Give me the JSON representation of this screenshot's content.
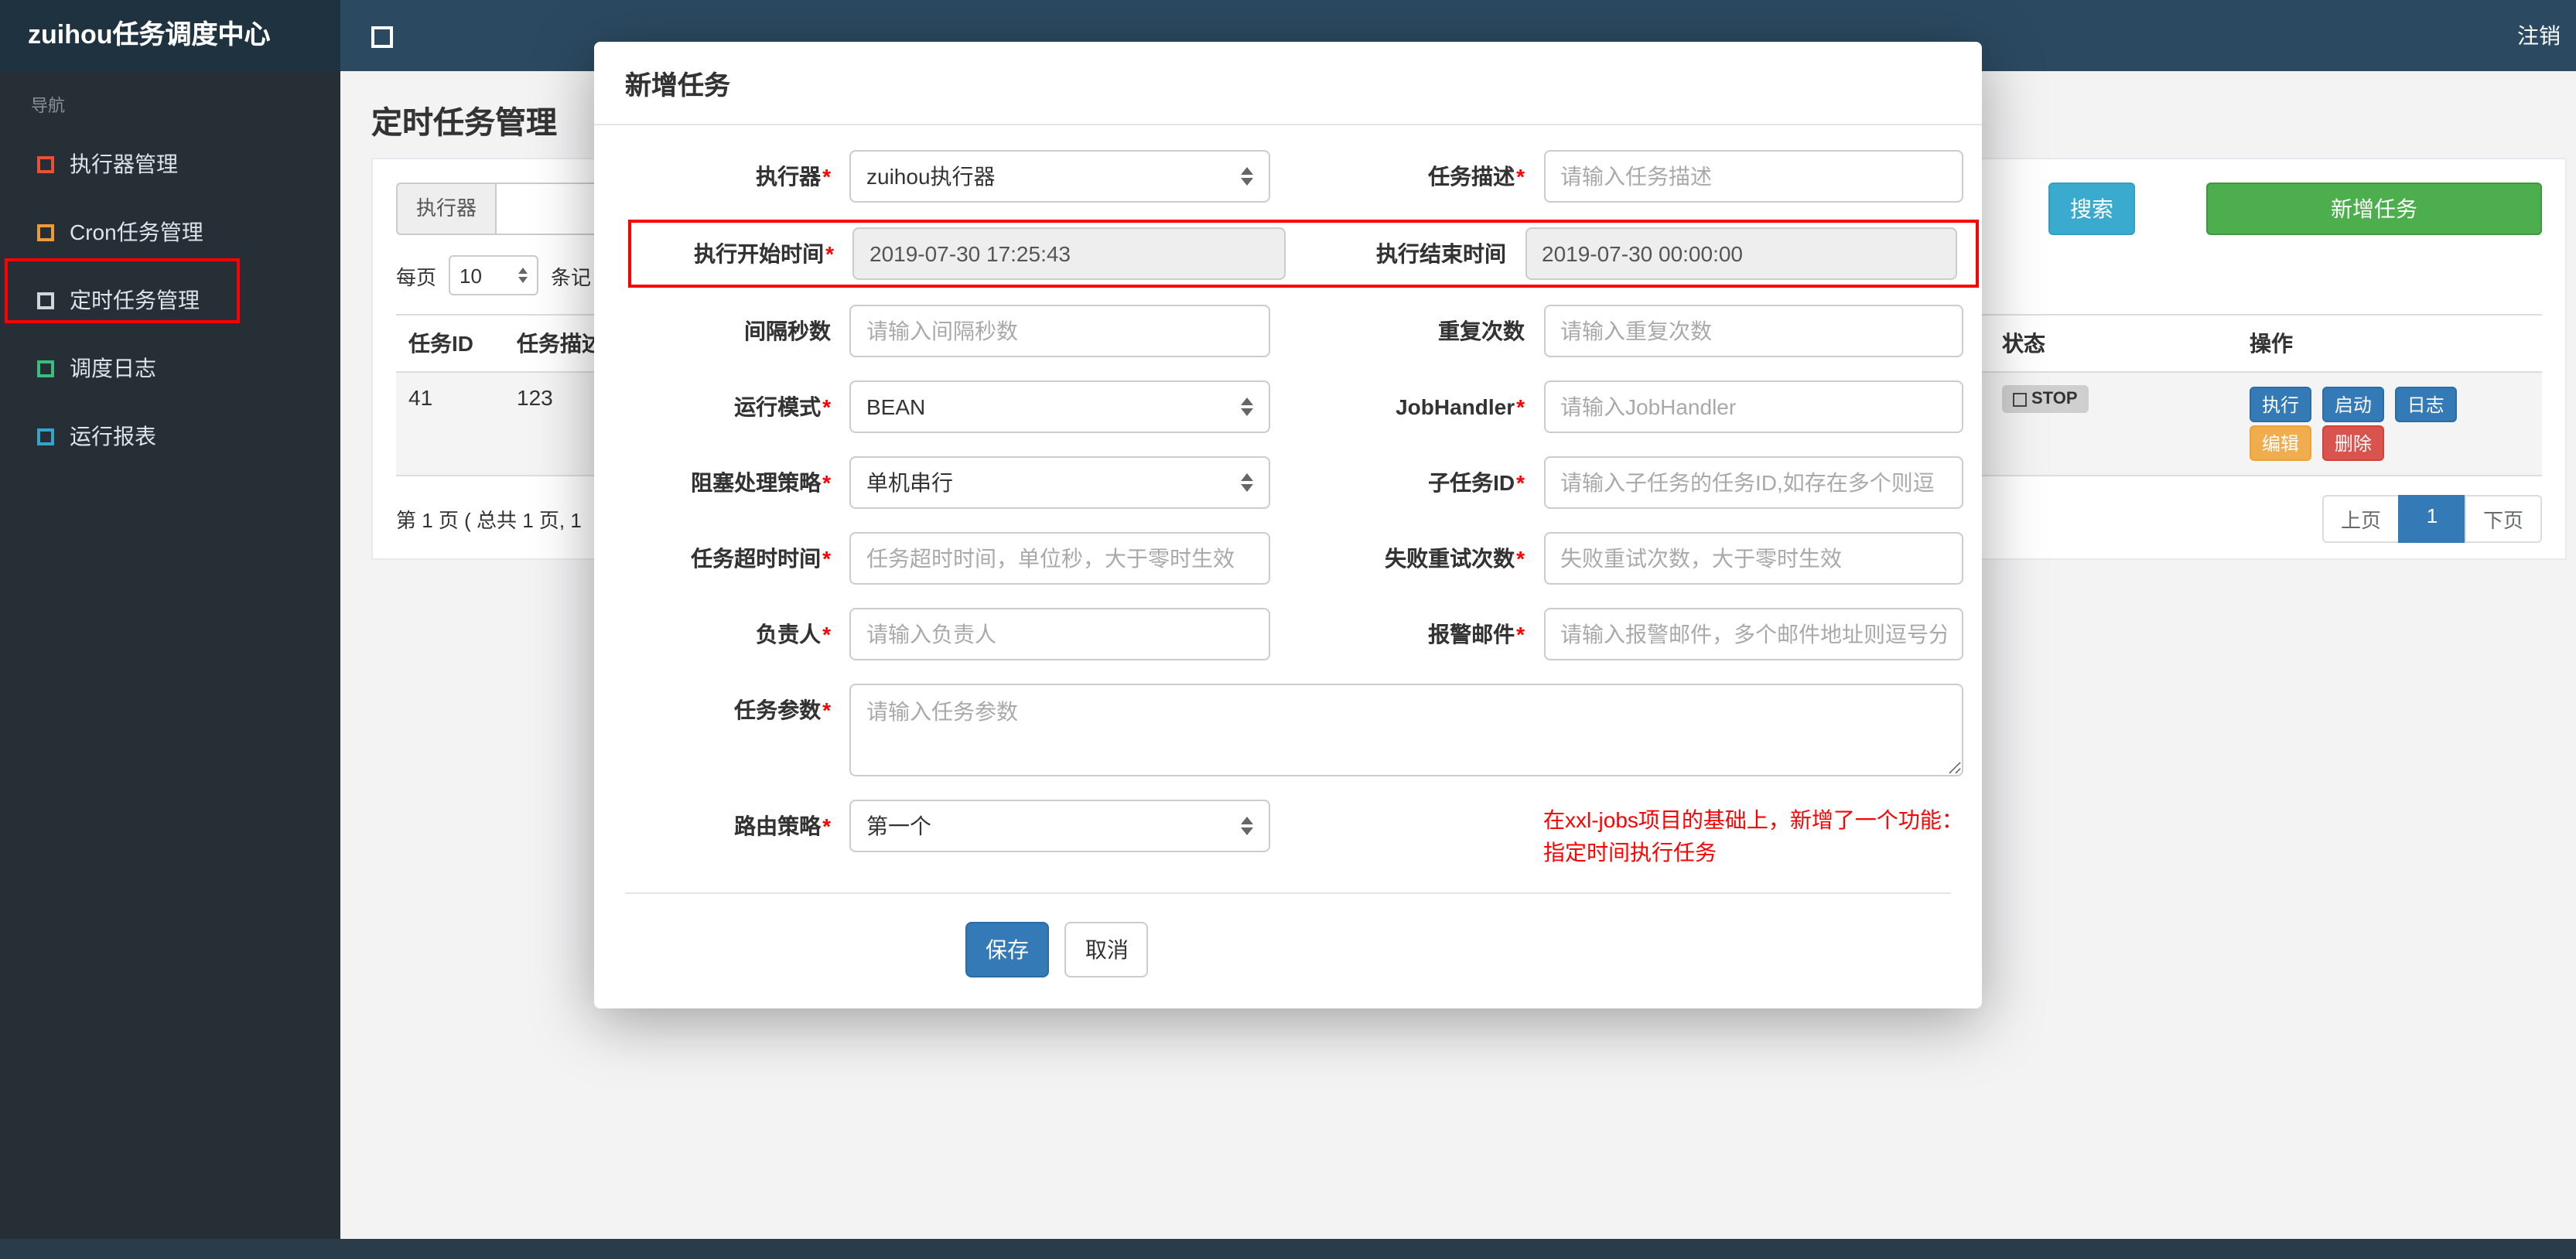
{
  "colors": {
    "navbar": "#2b4a61",
    "brand_bg": "#1e3240",
    "sidebar_bg": "#262f36",
    "annotation": "#ff0000",
    "search_button": "#3aabcf",
    "add_button": "#4cae4c",
    "primary_button": "#337ab7",
    "warning_button": "#f0ad4e",
    "danger_button": "#d9534f"
  },
  "navbar": {
    "brand": "zuihou任务调度中心",
    "logout": "注销"
  },
  "sidebar": {
    "section_label": "导航",
    "items": [
      {
        "label": "执行器管理"
      },
      {
        "label": "Cron任务管理"
      },
      {
        "label": "定时任务管理"
      },
      {
        "label": "调度日志"
      },
      {
        "label": "运行报表"
      }
    ]
  },
  "page": {
    "title": "定时任务管理",
    "filter": {
      "executor_label": "执行器",
      "search_button": "搜索",
      "add_button": "新增任务"
    },
    "per_page": {
      "prefix": "每页",
      "value": "10",
      "suffix": "条记"
    },
    "table": {
      "headers": [
        "任务ID",
        "任务描述",
        "状态",
        "操作"
      ],
      "row": {
        "id": "41",
        "desc": "123",
        "status": "STOP",
        "actions": [
          "执行",
          "启动",
          "日志",
          "编辑",
          "删除"
        ]
      }
    },
    "pagination": {
      "info": "第 1 页 ( 总共 1 页, 1",
      "prev": "上页",
      "current": "1",
      "next": "下页"
    }
  },
  "modal": {
    "title": "新增任务",
    "required_mark": "*",
    "fields": {
      "executor": {
        "label": "执行器",
        "value": "zuihou执行器"
      },
      "desc": {
        "label": "任务描述",
        "placeholder": "请输入任务描述"
      },
      "start_time": {
        "label": "执行开始时间",
        "value": "2019-07-30 17:25:43"
      },
      "end_time": {
        "label": "执行结束时间",
        "value": "2019-07-30 00:00:00"
      },
      "interval": {
        "label": "间隔秒数",
        "placeholder": "请输入间隔秒数"
      },
      "repeat": {
        "label": "重复次数",
        "placeholder": "请输入重复次数"
      },
      "run_mode": {
        "label": "运行模式",
        "value": "BEAN"
      },
      "job_handler": {
        "label": "JobHandler",
        "placeholder": "请输入JobHandler"
      },
      "block_strategy": {
        "label": "阻塞处理策略",
        "value": "单机串行"
      },
      "child_job": {
        "label": "子任务ID",
        "placeholder": "请输入子任务的任务ID,如存在多个则逗"
      },
      "timeout": {
        "label": "任务超时时间",
        "placeholder": "任务超时时间，单位秒，大于零时生效"
      },
      "retry": {
        "label": "失败重试次数",
        "placeholder": "失败重试次数，大于零时生效"
      },
      "owner": {
        "label": "负责人",
        "placeholder": "请输入负责人"
      },
      "alarm_email": {
        "label": "报警邮件",
        "placeholder": "请输入报警邮件，多个邮件地址则逗号分"
      },
      "job_param": {
        "label": "任务参数",
        "placeholder": "请输入任务参数"
      },
      "route_strategy": {
        "label": "路由策略",
        "value": "第一个"
      }
    },
    "note": {
      "line1": "在xxl-jobs项目的基础上，新增了一个功能：",
      "line2": "指定时间执行任务"
    },
    "save": "保存",
    "cancel": "取消"
  }
}
